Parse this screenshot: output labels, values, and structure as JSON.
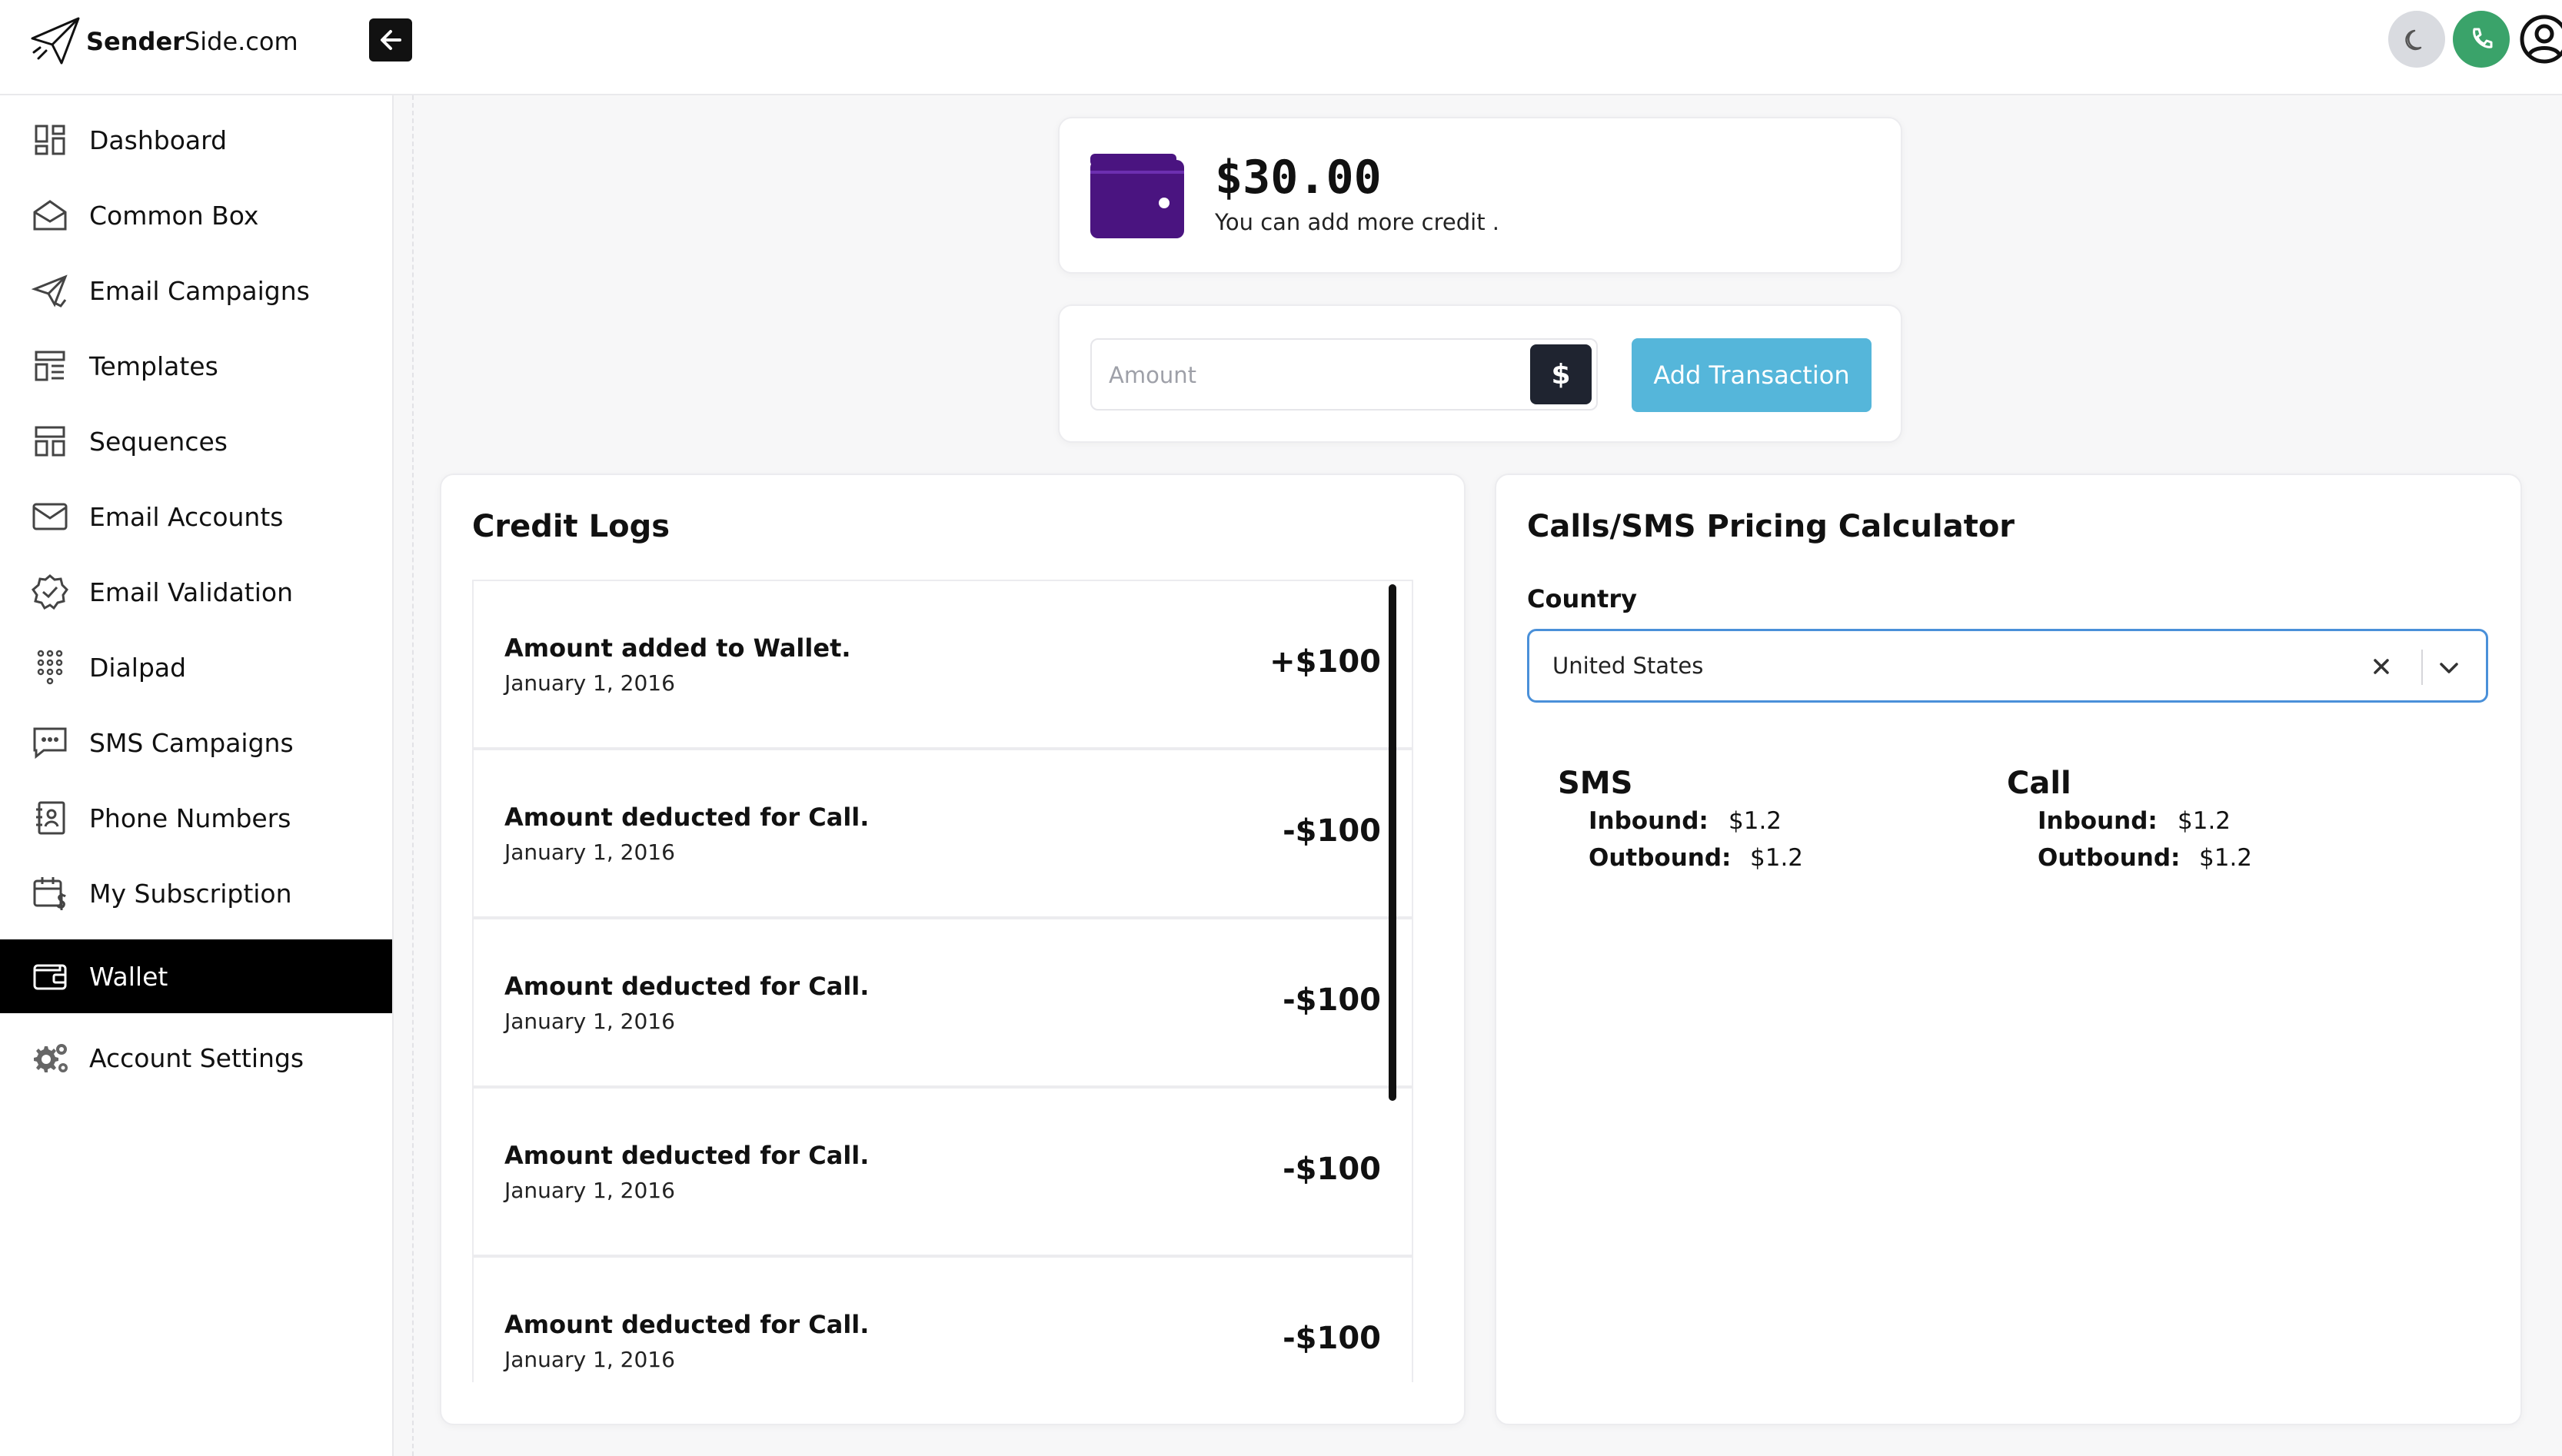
{
  "brand": {
    "name_bold": "Sender",
    "name_rest": "Side.com",
    "logo_icon": "paper-plane-icon"
  },
  "topbar": {
    "collapse_icon": "arrow-left-icon",
    "theme_icon": "moon-icon",
    "phone_icon": "phone-icon",
    "user_icon": "user-circle-icon",
    "phone_color": "#3aa36a"
  },
  "sidebar": {
    "items": [
      {
        "label": "Dashboard",
        "icon": "dashboard-icon"
      },
      {
        "label": "Common Box",
        "icon": "inbox-icon"
      },
      {
        "label": "Email Campaigns",
        "icon": "send-icon"
      },
      {
        "label": "Templates",
        "icon": "templates-icon"
      },
      {
        "label": "Sequences",
        "icon": "sequences-icon"
      },
      {
        "label": "Email Accounts",
        "icon": "envelope-icon"
      },
      {
        "label": "Email Validation",
        "icon": "verified-badge-icon"
      },
      {
        "label": "Dialpad",
        "icon": "dialpad-icon"
      },
      {
        "label": "SMS Campaigns",
        "icon": "message-icon"
      },
      {
        "label": "Phone Numbers",
        "icon": "contacts-icon"
      },
      {
        "label": "My Subscription",
        "icon": "calendar-dollar-icon"
      },
      {
        "label": "Wallet",
        "icon": "wallet-icon",
        "active": true
      },
      {
        "label": "Account Settings",
        "icon": "gears-icon"
      }
    ]
  },
  "balance": {
    "amount": "$30.00",
    "note": "You can add more credit .",
    "wallet_color": "#4a1480"
  },
  "transaction": {
    "placeholder": "Amount",
    "currency_symbol": "$",
    "button_label": "Add Transaction",
    "button_color": "#55b6da"
  },
  "credit_logs": {
    "title": "Credit Logs",
    "rows": [
      {
        "title": "Amount added to Wallet.",
        "date": "January 1, 2016",
        "amount": "+$100"
      },
      {
        "title": "Amount deducted for Call.",
        "date": "January 1, 2016",
        "amount": "-$100"
      },
      {
        "title": "Amount deducted for Call.",
        "date": "January 1, 2016",
        "amount": "-$100"
      },
      {
        "title": "Amount deducted for Call.",
        "date": "January 1, 2016",
        "amount": "-$100"
      },
      {
        "title": "Amount deducted for Call.",
        "date": "January 1, 2016",
        "amount": "-$100"
      }
    ]
  },
  "calculator": {
    "title": "Calls/SMS Pricing Calculator",
    "country_label": "Country",
    "country_value": "United States",
    "sms": {
      "heading": "SMS",
      "inbound_label": "Inbound:",
      "inbound_value": "$1.2",
      "outbound_label": "Outbound:",
      "outbound_value": "$1.2"
    },
    "call": {
      "heading": "Call",
      "inbound_label": "Inbound:",
      "inbound_value": "$1.2",
      "outbound_label": "Outbound:",
      "outbound_value": "$1.2"
    }
  }
}
